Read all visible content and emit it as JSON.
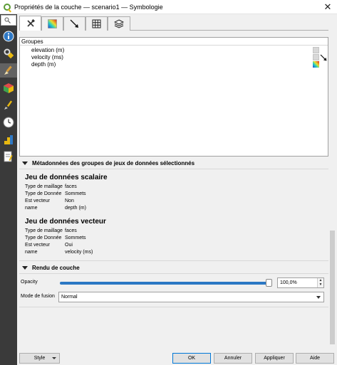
{
  "window": {
    "title": "Propriétés de la couche — scenario1 — Symbologie",
    "close_label": "✕"
  },
  "groups": {
    "header": "Groupes",
    "items": [
      {
        "label": "elevation (m)"
      },
      {
        "label": "velocity (ms)"
      },
      {
        "label": "depth (m)"
      }
    ]
  },
  "metadata": {
    "section_title": "Métadonnées des groupes de jeux de données sélectionnés",
    "scalar": {
      "title": "Jeu de données scalaire",
      "rows": [
        {
          "key": "Type de maillage",
          "value": "faces"
        },
        {
          "key": "Type de Donnée",
          "value": "Sommets"
        },
        {
          "key": "Est vecteur",
          "value": "Non"
        },
        {
          "key": "name",
          "value": "depth (m)"
        }
      ]
    },
    "vector": {
      "title": "Jeu de données vecteur",
      "rows": [
        {
          "key": "Type de maillage",
          "value": "faces"
        },
        {
          "key": "Type de Donnée",
          "value": "Sommets"
        },
        {
          "key": "Est vecteur",
          "value": "Oui"
        },
        {
          "key": "name",
          "value": "velocity (ms)"
        }
      ]
    }
  },
  "rendering": {
    "section_title": "Rendu de couche",
    "opacity_label": "Opacity",
    "opacity_value": "100,0%",
    "opacity_fraction": 1.0,
    "blend_label": "Mode de fusion",
    "blend_value": "Normal"
  },
  "buttons": {
    "style": "Style",
    "ok": "OK",
    "cancel": "Annuler",
    "apply": "Appliquer",
    "help": "Aide"
  },
  "colors": {
    "accent": "#2b78c4",
    "sidebar": "#3a3a3a"
  }
}
